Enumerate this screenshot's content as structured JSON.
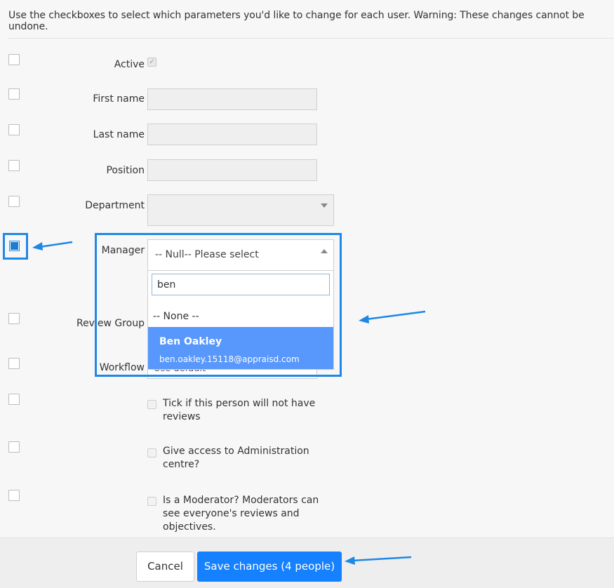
{
  "intro_text": "Use the checkboxes to select which parameters you'd like to change for each user. Warning: These changes cannot be undone.",
  "fields": {
    "active": "Active",
    "first_name": "First name",
    "last_name": "Last name",
    "position": "Position",
    "department": "Department",
    "manager": "Manager",
    "review_group": "Review Group",
    "workflow": "Workflow"
  },
  "manager_select": {
    "value": "-- Null-- Please select",
    "search_value": "ben",
    "options": [
      {
        "label": "-- None --"
      },
      {
        "name": "Ben Oakley",
        "email": "ben.oakley.15118@appraisd.com",
        "highlighted": true
      }
    ]
  },
  "workflow_partial_value": "Use default",
  "checkbox_options": {
    "no_reviews": "Tick if this person will not have reviews",
    "admin_access": "Give access to Administration centre?",
    "moderator": "Is a Moderator? Moderators can see everyone's reviews and objectives."
  },
  "buttons": {
    "cancel": "Cancel",
    "save": "Save changes (4 people)"
  },
  "colors": {
    "accent": "#1581ff",
    "highlight": "#5897fb",
    "annotation": "#1e88e5"
  }
}
